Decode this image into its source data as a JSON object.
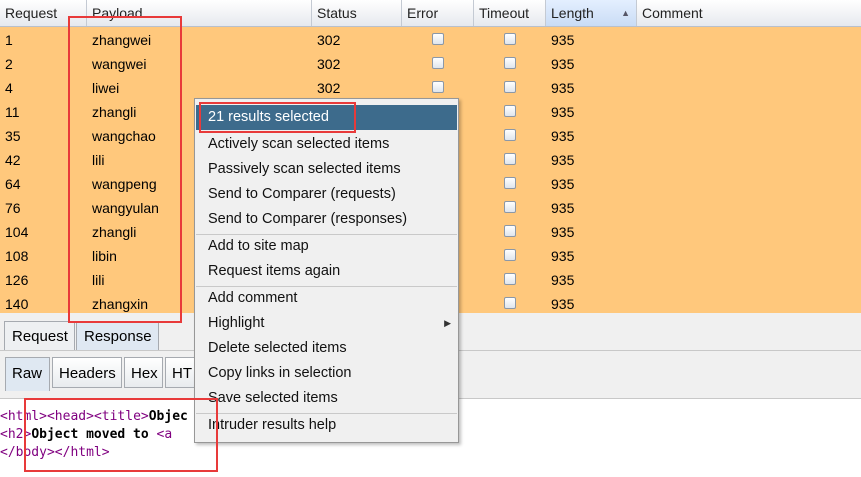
{
  "table": {
    "columns": [
      "Request",
      "Payload",
      "Status",
      "Error",
      "Timeout",
      "Length",
      "Comment"
    ],
    "sorted_column": "Length",
    "sort_icon": "sort-ascending-icon",
    "row_highlight_color": "#ffc87c",
    "rows": [
      {
        "request": "1",
        "payload": "zhangwei",
        "status": "302",
        "error": false,
        "timeout": false,
        "length": "935"
      },
      {
        "request": "2",
        "payload": "wangwei",
        "status": "302",
        "error": false,
        "timeout": false,
        "length": "935"
      },
      {
        "request": "4",
        "payload": "liwei",
        "status": "302",
        "error": false,
        "timeout": false,
        "length": "935"
      },
      {
        "request": "11",
        "payload": "zhangli",
        "status": "",
        "error": false,
        "timeout": false,
        "length": "935"
      },
      {
        "request": "35",
        "payload": "wangchao",
        "status": "",
        "error": false,
        "timeout": false,
        "length": "935"
      },
      {
        "request": "42",
        "payload": "lili",
        "status": "",
        "error": false,
        "timeout": false,
        "length": "935"
      },
      {
        "request": "64",
        "payload": "wangpeng",
        "status": "",
        "error": false,
        "timeout": false,
        "length": "935"
      },
      {
        "request": "76",
        "payload": "wangyulan",
        "status": "",
        "error": false,
        "timeout": false,
        "length": "935"
      },
      {
        "request": "104",
        "payload": "zhangli",
        "status": "",
        "error": false,
        "timeout": false,
        "length": "935"
      },
      {
        "request": "108",
        "payload": "libin",
        "status": "",
        "error": false,
        "timeout": false,
        "length": "935"
      },
      {
        "request": "126",
        "payload": "lili",
        "status": "",
        "error": false,
        "timeout": false,
        "length": "935"
      },
      {
        "request": "140",
        "payload": "zhangxin",
        "status": "",
        "error": false,
        "timeout": false,
        "length": "935"
      }
    ]
  },
  "tabs": {
    "top": [
      "Request",
      "Response"
    ],
    "top_active": "Response",
    "view": [
      "Raw",
      "Headers",
      "Hex",
      "HT"
    ],
    "view_active": "Raw"
  },
  "response_code": {
    "line1": {
      "a": "<html>",
      "b": "<head>",
      "c": "<title>",
      "d": "Objec"
    },
    "line2": {
      "a": "<h2>",
      "b": "Object moved to ",
      "c": "<a"
    },
    "line3": {
      "a": "</body>",
      "b": "</html>"
    }
  },
  "context_menu": {
    "header": "21 results selected",
    "groups": [
      [
        "Actively scan selected items",
        "Passively scan selected items",
        "Send to Comparer (requests)",
        "Send to Comparer (responses)"
      ],
      [
        "Add to site map",
        "Request items again"
      ],
      [
        "Add comment",
        "Highlight",
        "Delete selected items",
        "Copy links in selection",
        "Save selected items"
      ],
      [
        "Intruder results help"
      ]
    ],
    "submenu_item": "Highlight",
    "submenu_icon": "chevron-right-icon",
    "selected_color": "#3d6b8c"
  },
  "annotation_color": "#e83a3a"
}
